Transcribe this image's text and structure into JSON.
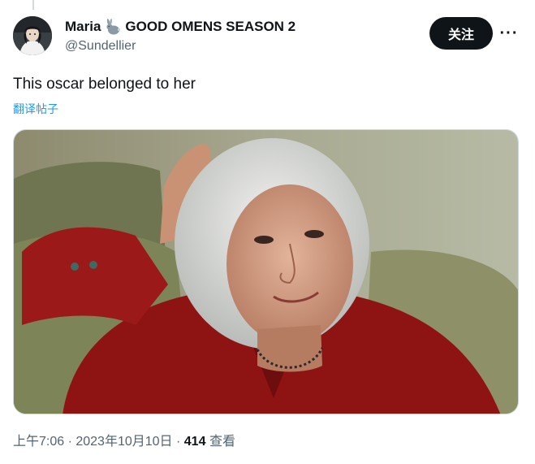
{
  "tweet": {
    "author": {
      "name": "Maria",
      "name_suffix": "GOOD OMENS SEASON 2",
      "handle": "@Sundellier",
      "avatar_icon": "avatar-illustrated-person",
      "name_emoji_icon": "rabbit-icon"
    },
    "follow_label": "关注",
    "more_icon": "more-horizontal-icon",
    "more_label": "···",
    "text": "This oscar belonged to her",
    "translate_label": "翻译帖子",
    "media_description_icon": "photo",
    "timestamp": "上午7:06 · 2023年10月10日",
    "separator": " · ",
    "views_count": "414",
    "views_label": "查看"
  },
  "colors": {
    "text_primary": "#0f1419",
    "text_secondary": "#536471",
    "link": "#1d9bf0",
    "follow_bg": "#0f1419",
    "follow_text": "#ffffff"
  }
}
